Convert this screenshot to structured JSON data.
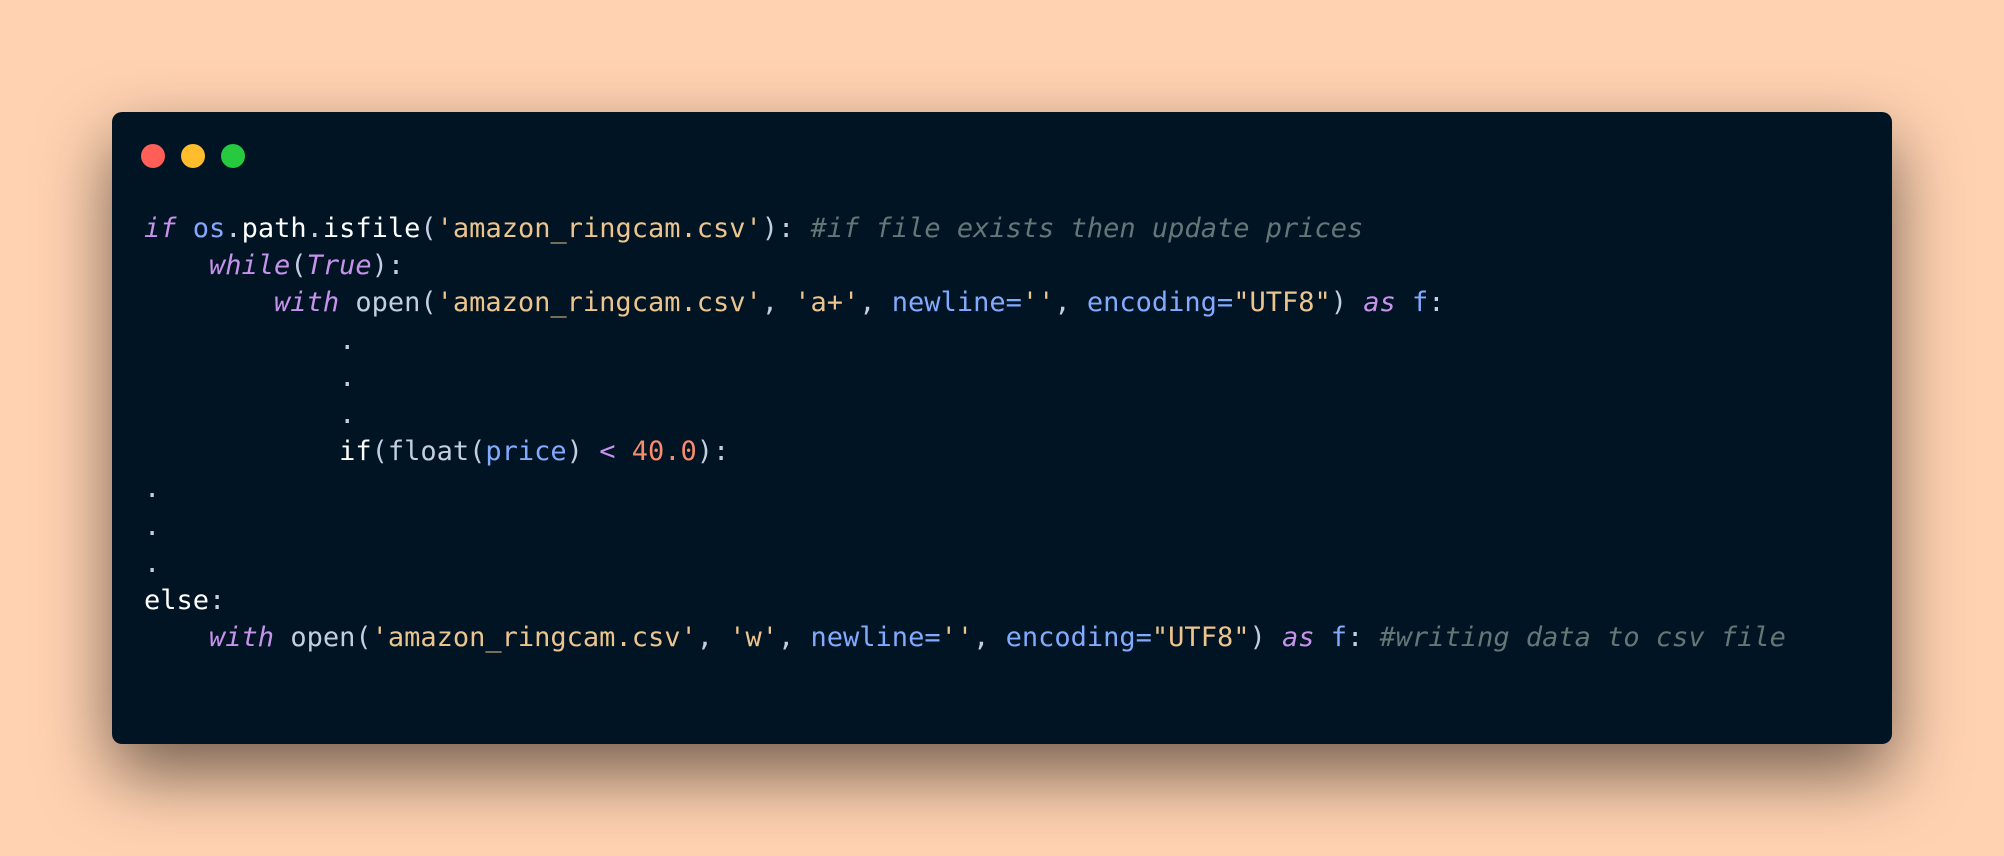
{
  "window": {
    "dots": [
      {
        "name": "close",
        "color": "#FF5F56"
      },
      {
        "name": "minimize",
        "color": "#FFBD2E"
      },
      {
        "name": "maximize",
        "color": "#27C93F"
      }
    ]
  },
  "code_lines": [
    [
      {
        "t": "if",
        "c": "kw"
      },
      {
        "t": " ",
        "c": "plain"
      },
      {
        "t": "os",
        "c": "var"
      },
      {
        "t": ".",
        "c": "punc"
      },
      {
        "t": "path",
        "c": "plain"
      },
      {
        "t": ".",
        "c": "punc"
      },
      {
        "t": "isfile",
        "c": "plain"
      },
      {
        "t": "(",
        "c": "punc"
      },
      {
        "t": "'amazon_ringcam.csv'",
        "c": "str"
      },
      {
        "t": "): ",
        "c": "punc"
      },
      {
        "t": "#if file exists then update prices",
        "c": "cmt"
      }
    ],
    [
      {
        "t": "    ",
        "c": "plain"
      },
      {
        "t": "while",
        "c": "kw"
      },
      {
        "t": "(",
        "c": "punc"
      },
      {
        "t": "True",
        "c": "kw"
      },
      {
        "t": "):",
        "c": "punc"
      }
    ],
    [
      {
        "t": "        ",
        "c": "plain"
      },
      {
        "t": "with",
        "c": "kw"
      },
      {
        "t": " open(",
        "c": "fn"
      },
      {
        "t": "'amazon_ringcam.csv'",
        "c": "str"
      },
      {
        "t": ", ",
        "c": "punc"
      },
      {
        "t": "'a+'",
        "c": "str"
      },
      {
        "t": ", ",
        "c": "punc"
      },
      {
        "t": "newline=",
        "c": "var"
      },
      {
        "t": "''",
        "c": "str"
      },
      {
        "t": ", ",
        "c": "punc"
      },
      {
        "t": "encoding=",
        "c": "var"
      },
      {
        "t": "\"UTF8\"",
        "c": "str"
      },
      {
        "t": ") ",
        "c": "punc"
      },
      {
        "t": "as",
        "c": "kw"
      },
      {
        "t": " f",
        "c": "var"
      },
      {
        "t": ":",
        "c": "punc"
      }
    ],
    [
      {
        "t": "            .",
        "c": "punc"
      }
    ],
    [
      {
        "t": "            .",
        "c": "punc"
      }
    ],
    [
      {
        "t": "            .",
        "c": "punc"
      }
    ],
    [
      {
        "t": "            ",
        "c": "plain"
      },
      {
        "t": "if",
        "c": "plain"
      },
      {
        "t": "(float(",
        "c": "fn"
      },
      {
        "t": "price",
        "c": "var"
      },
      {
        "t": ") ",
        "c": "punc"
      },
      {
        "t": "<",
        "c": "op"
      },
      {
        "t": " ",
        "c": "plain"
      },
      {
        "t": "40.0",
        "c": "num"
      },
      {
        "t": "):",
        "c": "punc"
      }
    ],
    [
      {
        "t": ".",
        "c": "punc"
      }
    ],
    [
      {
        "t": ".",
        "c": "punc"
      }
    ],
    [
      {
        "t": ".",
        "c": "punc"
      }
    ],
    [
      {
        "t": "else",
        "c": "plain"
      },
      {
        "t": ":",
        "c": "punc"
      }
    ],
    [
      {
        "t": "    ",
        "c": "plain"
      },
      {
        "t": "with",
        "c": "kw"
      },
      {
        "t": " open(",
        "c": "fn"
      },
      {
        "t": "'amazon_ringcam.csv'",
        "c": "str"
      },
      {
        "t": ", ",
        "c": "punc"
      },
      {
        "t": "'w'",
        "c": "str"
      },
      {
        "t": ", ",
        "c": "punc"
      },
      {
        "t": "newline=",
        "c": "var"
      },
      {
        "t": "''",
        "c": "str"
      },
      {
        "t": ", ",
        "c": "punc"
      },
      {
        "t": "encoding=",
        "c": "var"
      },
      {
        "t": "\"UTF8\"",
        "c": "str"
      },
      {
        "t": ") ",
        "c": "punc"
      },
      {
        "t": "as",
        "c": "kw"
      },
      {
        "t": " f",
        "c": "var"
      },
      {
        "t": ": ",
        "c": "punc"
      },
      {
        "t": "#writing data to csv file",
        "c": "cmt"
      }
    ]
  ]
}
